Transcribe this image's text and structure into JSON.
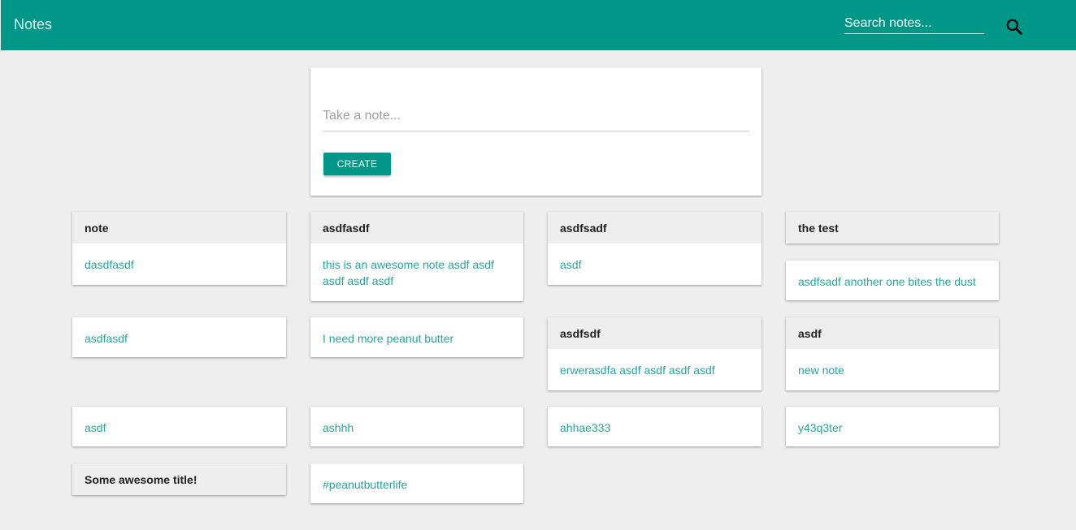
{
  "app": {
    "title": "Notes"
  },
  "search": {
    "placeholder": "Search notes...",
    "icon": "search-icon"
  },
  "composer": {
    "placeholder": "Take a note...",
    "create_label": "CREATE"
  },
  "colors": {
    "primary": "#009688",
    "body_text": "#26a69a",
    "background": "#eeeeee"
  },
  "notes": [
    {
      "title": "note",
      "body": "dasdfasdf"
    },
    {
      "title": "asdfasdf",
      "body": "this is an awesome note asdf asdf asdf asdf asdf"
    },
    {
      "title": "asdfsadf",
      "body": "asdf"
    },
    {
      "title": "the test",
      "body": ""
    },
    {
      "title": "",
      "body": "asdfsadf another one bites the dust"
    },
    {
      "title": "",
      "body": "asdfasdf"
    },
    {
      "title": "",
      "body": "I need more peanut butter"
    },
    {
      "title": "asdfsdf",
      "body": "erwerasdfa asdf asdf asdf asdf"
    },
    {
      "title": "asdf",
      "body": "new note"
    },
    {
      "title": "",
      "body": "asdf"
    },
    {
      "title": "",
      "body": "ashhh"
    },
    {
      "title": "",
      "body": "ahhae333"
    },
    {
      "title": "",
      "body": "y43q3ter"
    },
    {
      "title": "Some awesome title!",
      "body": ""
    },
    {
      "title": "",
      "body": "#peanutbutterlife"
    }
  ]
}
